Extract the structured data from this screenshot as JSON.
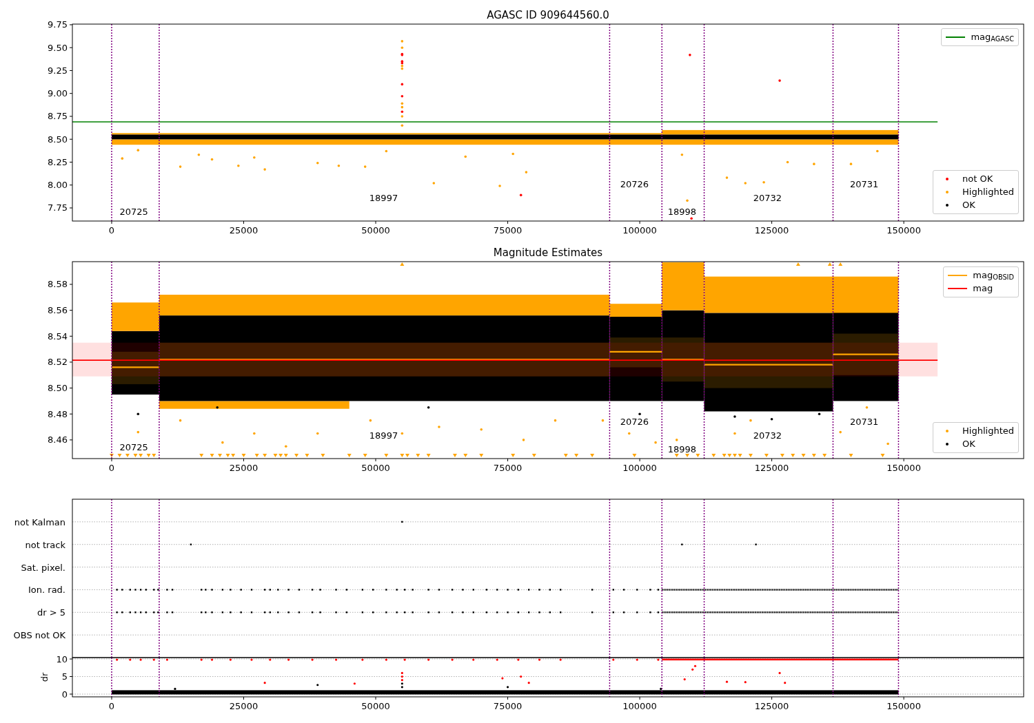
{
  "panels": [
    {
      "title": "AGASC ID 909644560.0",
      "y_ticks": [
        "9.75",
        "9.50",
        "9.25",
        "9.00",
        "8.75",
        "8.50",
        "8.25",
        "8.00",
        "7.75"
      ],
      "x_ticks": [
        "0",
        "25000",
        "50000",
        "75000",
        "100000",
        "125000",
        "150000"
      ],
      "legends": [
        {
          "items": [
            {
              "label": "mag$_{AGASC}$",
              "kind": "line",
              "color": "#008000"
            }
          ]
        },
        {
          "items": [
            {
              "label": "not OK",
              "kind": "dot",
              "color": "#ff0000"
            },
            {
              "label": "Highlighted",
              "kind": "dot",
              "color": "#ffa500"
            },
            {
              "label": "OK",
              "kind": "dot",
              "color": "#000000"
            }
          ]
        }
      ],
      "obsid_labels": [
        "20725",
        "18997",
        "20726",
        "18998",
        "20732",
        "20731"
      ]
    },
    {
      "title": "Magnitude Estimates",
      "y_ticks": [
        "8.58",
        "8.56",
        "8.54",
        "8.52",
        "8.50",
        "8.48",
        "8.46"
      ],
      "x_ticks": [
        "0",
        "25000",
        "50000",
        "75000",
        "100000",
        "125000",
        "150000"
      ],
      "legends": [
        {
          "items": [
            {
              "label": "mag$_{OBSID}$",
              "kind": "line",
              "color": "#ffa500"
            },
            {
              "label": "mag",
              "kind": "line",
              "color": "#ff0000"
            }
          ]
        },
        {
          "items": [
            {
              "label": "Highlighted",
              "kind": "dot",
              "color": "#ffa500"
            },
            {
              "label": "OK",
              "kind": "dot",
              "color": "#000000"
            }
          ]
        }
      ],
      "obsid_labels": [
        "20725",
        "18997",
        "20726",
        "18998",
        "20732",
        "20731"
      ]
    },
    {
      "categories": [
        "not Kalman",
        "not track",
        "Sat. pixel.",
        "Ion. rad.",
        "dr > 5",
        "OBS not OK"
      ]
    },
    {
      "y_label": "dr",
      "y_ticks": [
        "10",
        "5",
        "0"
      ],
      "x_ticks": [
        "0",
        "25000",
        "50000",
        "75000",
        "100000",
        "125000",
        "150000"
      ]
    }
  ]
}
